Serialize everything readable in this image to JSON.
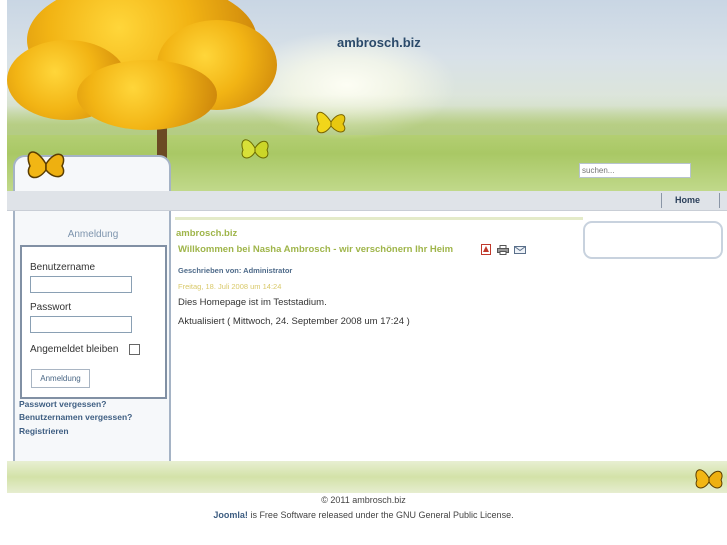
{
  "header": {
    "site_title": "ambrosch.biz",
    "search_placeholder": "suchen..."
  },
  "nav": {
    "items": [
      {
        "label": "Home"
      }
    ]
  },
  "login": {
    "title": "Anmeldung",
    "username_label": "Benutzername",
    "password_label": "Passwort",
    "remember_label": "Angemeldet bleiben",
    "remember_checked": false,
    "submit_label": "Anmeldung",
    "links": [
      {
        "label": "Passwort vergessen?"
      },
      {
        "label": "Benutzernamen vergessen?"
      },
      {
        "label": "Registrieren"
      }
    ]
  },
  "content": {
    "section_title": "ambrosch.biz",
    "article_title": "Willkommen bei Nasha Ambrosch - wir verschönern Ihr Heim",
    "icons": [
      "pdf-icon",
      "print-icon",
      "email-icon"
    ],
    "author": "Geschrieben von: Administrator",
    "date": "Freitag, 18. Juli 2008 um 14:24",
    "body": "Dies Homepage ist im Teststadium.",
    "updated": "Aktualisiert ( Mittwoch, 24. September 2008 um 17:24 )"
  },
  "footer": {
    "copyright": "© 2011 ambrosch.biz",
    "joomla": "Joomla!",
    "license_rest": " is Free Software released under the GNU General Public License."
  },
  "colors": {
    "accent_green": "#9fb54a",
    "link_blue": "#3e5e82"
  }
}
